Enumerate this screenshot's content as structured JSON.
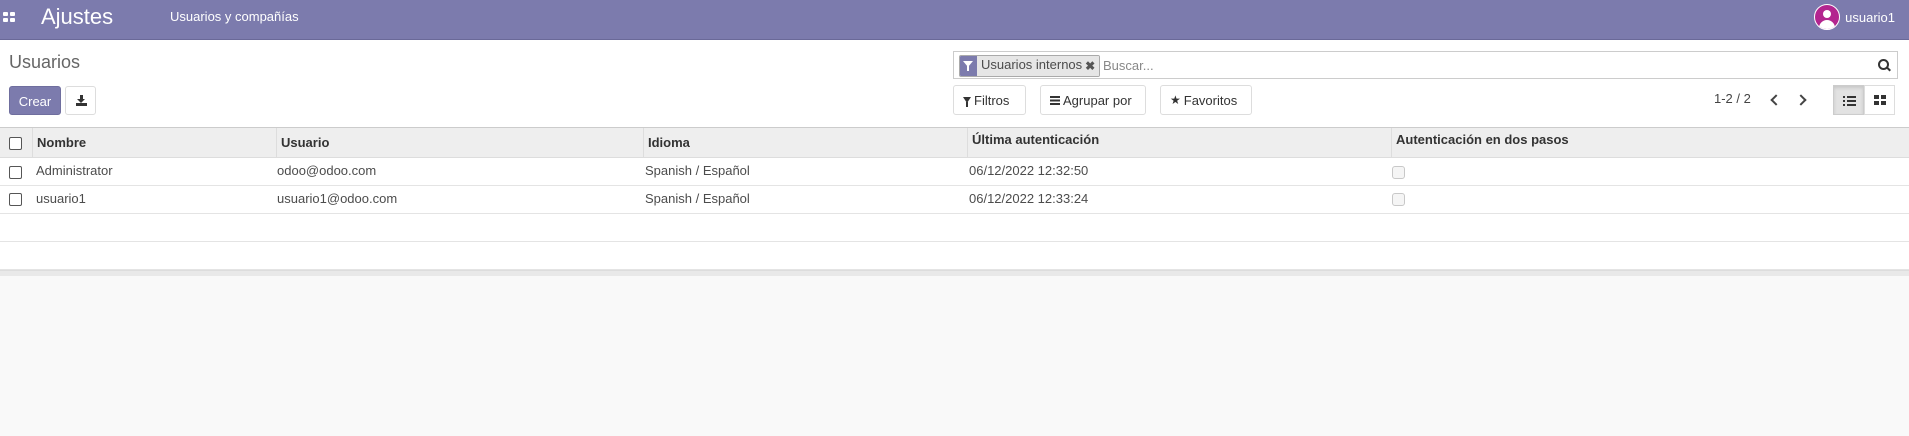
{
  "navbar": {
    "app_title": "Ajustes",
    "menu_item": "Usuarios y compañías",
    "user_name": "usuario1",
    "color": "#7c7bad"
  },
  "control_panel": {
    "breadcrumb_title": "Usuarios",
    "create_label": "Crear",
    "search": {
      "facet_value": "Usuarios internos",
      "placeholder": "Buscar..."
    },
    "filters_label": "Filtros",
    "group_by_label": "Agrupar por",
    "favorites_label": "Favoritos",
    "pager_value": "1-2 / 2",
    "active_view": "list"
  },
  "table": {
    "headers": [
      "Nombre",
      "Usuario",
      "Idioma",
      "Última autenticación",
      "Autenticación en dos pasos"
    ],
    "rows": [
      {
        "name": "Administrator",
        "login": "odoo@odoo.com",
        "lang": "Spanish / Español",
        "last_login": "06/12/2022 12:32:50",
        "two_factor": false
      },
      {
        "name": "usuario1",
        "login": "usuario1@odoo.com",
        "lang": "Spanish / Español",
        "last_login": "06/12/2022 12:33:24",
        "two_factor": false
      }
    ]
  }
}
